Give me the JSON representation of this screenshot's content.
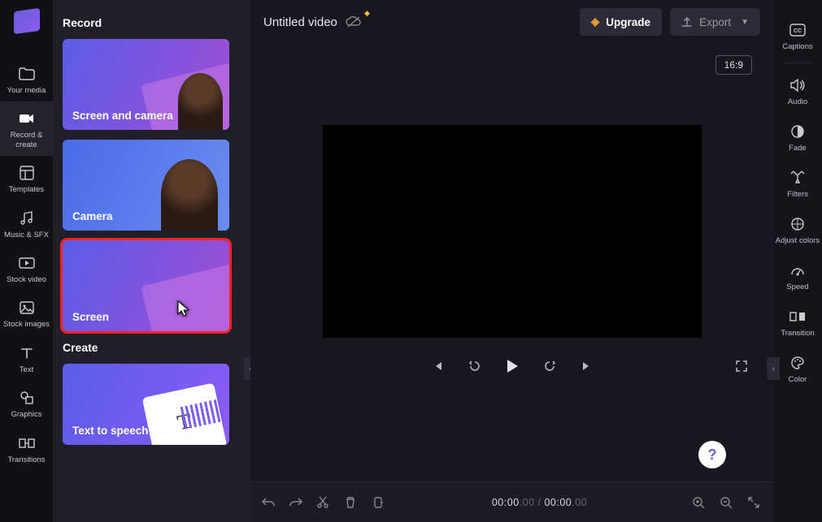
{
  "app": {
    "title": "Untitled video"
  },
  "aspect_ratio": "16:9",
  "left_nav": [
    {
      "id": "your-media",
      "label": "Your media"
    },
    {
      "id": "record-create",
      "label": "Record & create"
    },
    {
      "id": "templates",
      "label": "Templates"
    },
    {
      "id": "music-sfx",
      "label": "Music & SFX"
    },
    {
      "id": "stock-video",
      "label": "Stock video"
    },
    {
      "id": "stock-images",
      "label": "Stock images"
    },
    {
      "id": "text",
      "label": "Text"
    },
    {
      "id": "graphics",
      "label": "Graphics"
    },
    {
      "id": "transitions",
      "label": "Transitions"
    }
  ],
  "panel": {
    "record_header": "Record",
    "create_header": "Create",
    "cards": {
      "screen_and_camera": "Screen and camera",
      "camera": "Camera",
      "screen": "Screen",
      "text_to_speech": "Text to speech"
    }
  },
  "topbar": {
    "upgrade_label": "Upgrade",
    "export_label": "Export"
  },
  "timeline": {
    "current": "00:00",
    "current_frac": ".00",
    "total": "00:00",
    "total_frac": ".00",
    "separator": " / "
  },
  "right_rail": [
    {
      "id": "captions",
      "label": "Captions"
    },
    {
      "id": "audio",
      "label": "Audio"
    },
    {
      "id": "fade",
      "label": "Fade"
    },
    {
      "id": "filters",
      "label": "Filters"
    },
    {
      "id": "adjust",
      "label": "Adjust colors"
    },
    {
      "id": "speed",
      "label": "Speed"
    },
    {
      "id": "transition",
      "label": "Transition"
    },
    {
      "id": "color",
      "label": "Color"
    }
  ],
  "help": "?"
}
